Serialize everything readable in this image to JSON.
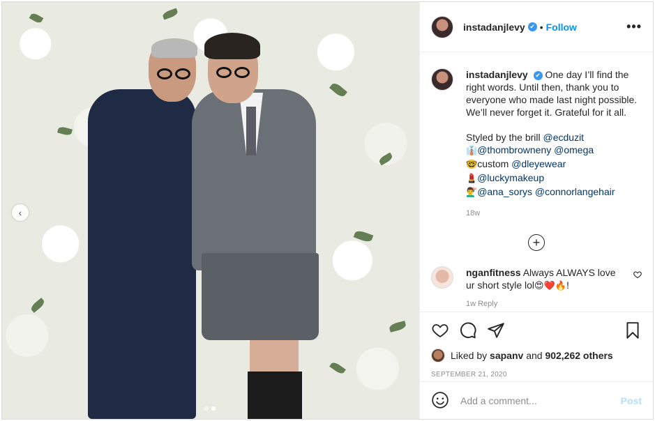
{
  "post": {
    "username": "instadanjlevy",
    "follow_label": "Follow",
    "separator": "•",
    "more_label": "•••",
    "verified_mark": "✔"
  },
  "caption": {
    "username": "instadanjlevy",
    "text": "One day I’ll find the right words. Until then, thank you to everyone who made last night possible. We’ll never forget it. Grateful for it all.",
    "styled_prefix": "Styled by the brill",
    "tags": {
      "ecduzit": "@ecduzit",
      "thombrowneny": "@thombrowneny",
      "omega": "@omega",
      "dleyewear": "@dleyewear",
      "luckymakeup": "@luckymakeup",
      "ana_sorys": "@ana_sorys",
      "connorlangehair": "@connorlangehair"
    },
    "emojis": {
      "line2": "👔",
      "line3": "🤓",
      "line4": "💄",
      "line5": "💇‍♂️"
    },
    "custom_word": "custom",
    "age": "18w"
  },
  "comment": {
    "username": "nganfitness",
    "text": "Always ALWAYS love ur short style lol",
    "emojis": "😍❤️🔥",
    "suffix": "!",
    "meta": "1w   Reply"
  },
  "actions": {
    "liked_by_prefix": "Liked by",
    "liked_by_user": "sapanv",
    "and_word": "and",
    "others_count": "902,262 others",
    "date": "SEPTEMBER 21, 2020"
  },
  "add_comment": {
    "placeholder": "Add a comment...",
    "post_label": "Post"
  },
  "icons": {
    "more": "more-dots-icon",
    "like": "heart-icon",
    "comment": "comment-bubble-icon",
    "share": "paper-plane-icon",
    "save": "bookmark-icon",
    "emoji": "smiley-icon",
    "load": "plus-circle-icon",
    "prev": "chevron-left-icon"
  },
  "colors": {
    "accent": "#0095f6",
    "post_disabled": "#b2dffc",
    "verified": "#3897f0",
    "text": "#262626",
    "muted": "#8e8e8e"
  },
  "carousel": {
    "slides": 2,
    "active": 1
  }
}
